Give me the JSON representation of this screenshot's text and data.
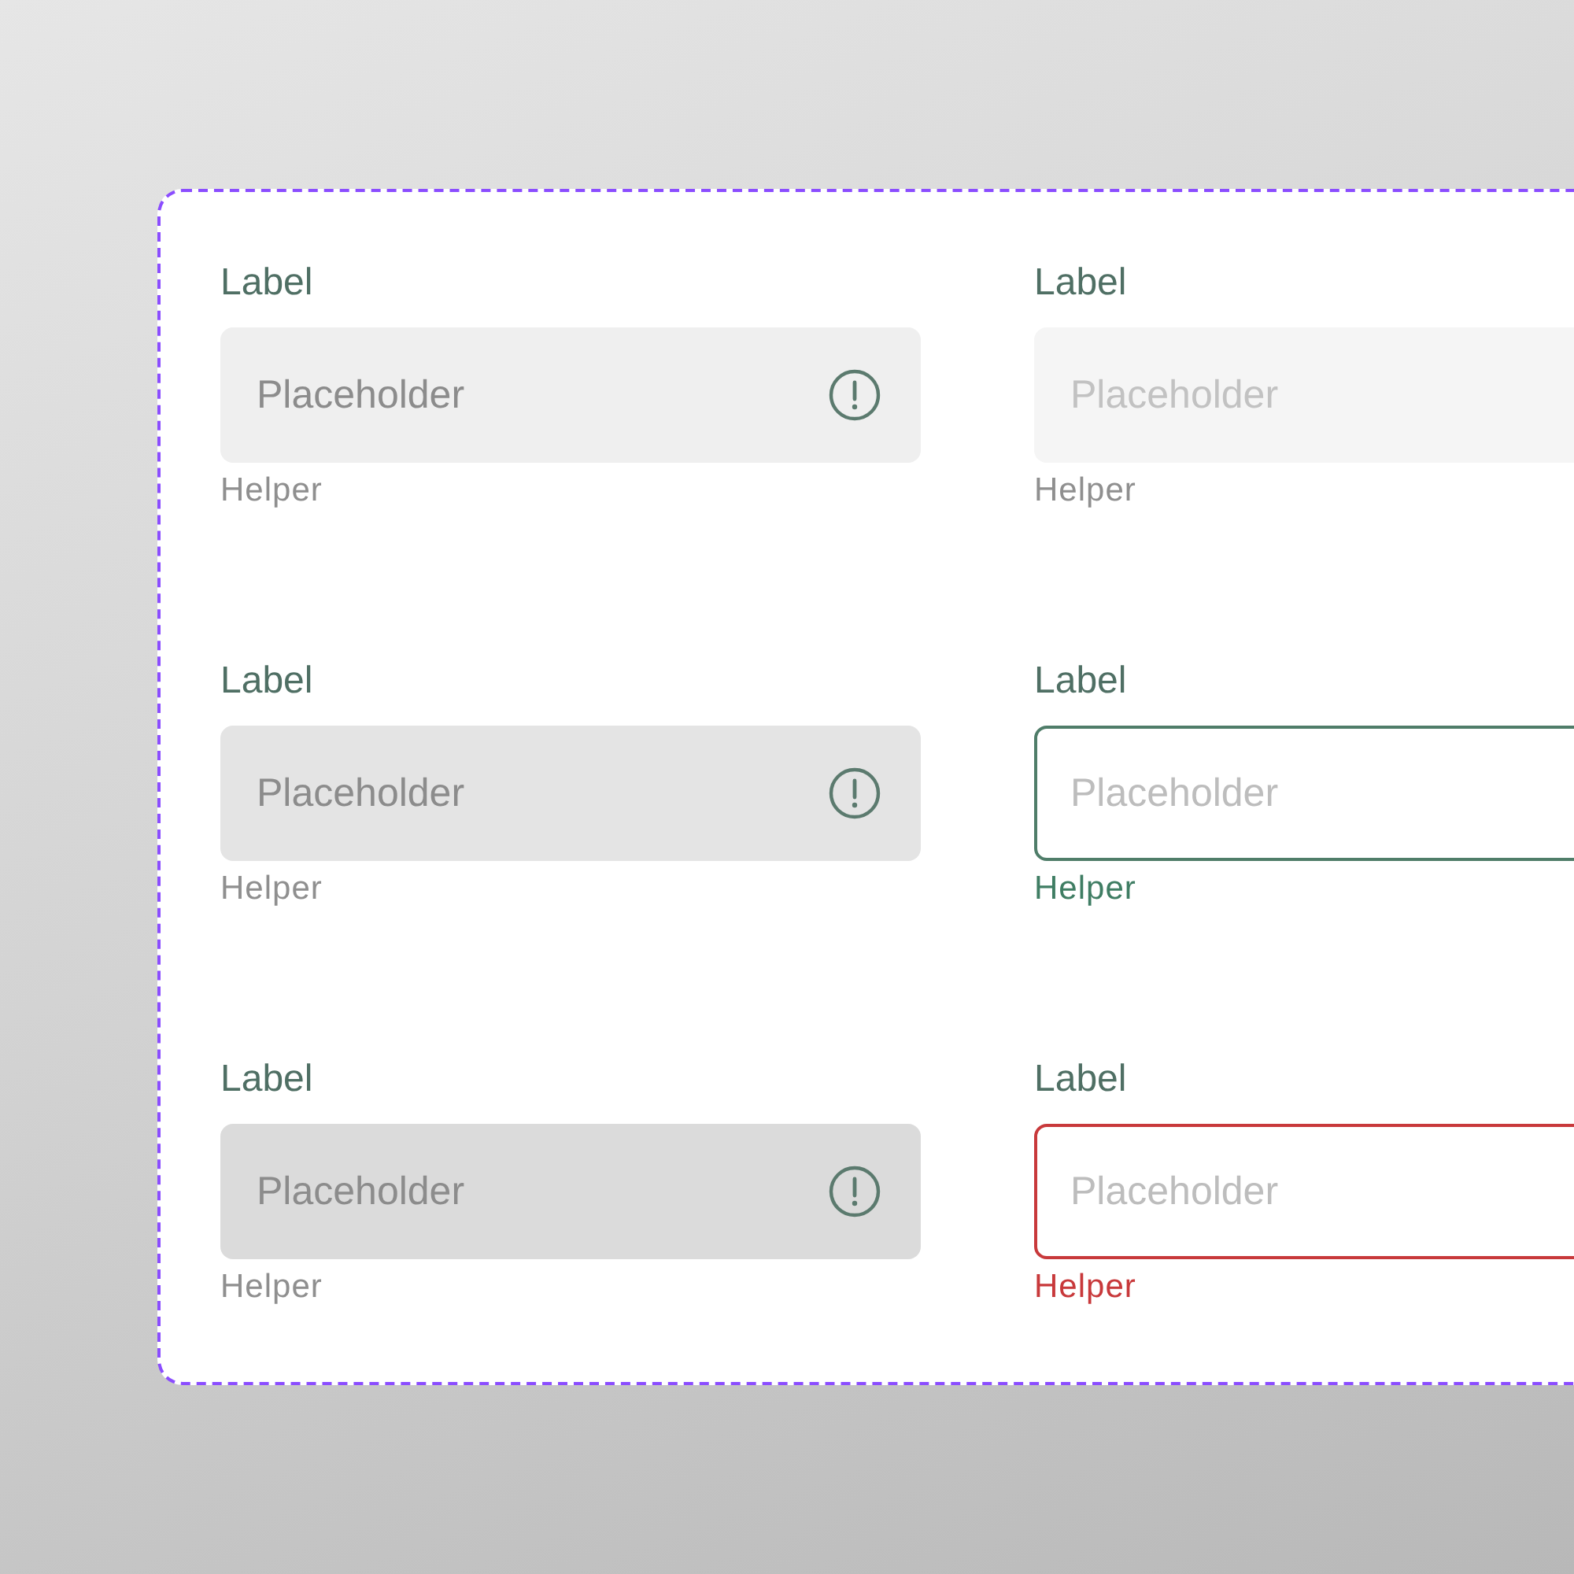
{
  "fields": [
    {
      "label": "Label",
      "placeholder": "Placeholder",
      "helper": "Helper",
      "kind": "default",
      "icon": true
    },
    {
      "label": "Label",
      "placeholder": "Placeholder",
      "helper": "Helper",
      "kind": "disabled"
    },
    {
      "label": "Label",
      "placeholder": "Placeholder",
      "helper": "Helper",
      "kind": "hover",
      "icon": true
    },
    {
      "label": "Label",
      "placeholder": "Placeholder",
      "helper": "Helper",
      "kind": "focus"
    },
    {
      "label": "Label",
      "placeholder": "Placeholder",
      "helper": "Helper",
      "kind": "pressed",
      "icon": true
    },
    {
      "label": "Label",
      "placeholder": "Placeholder",
      "helper": "Helper",
      "kind": "error"
    }
  ]
}
